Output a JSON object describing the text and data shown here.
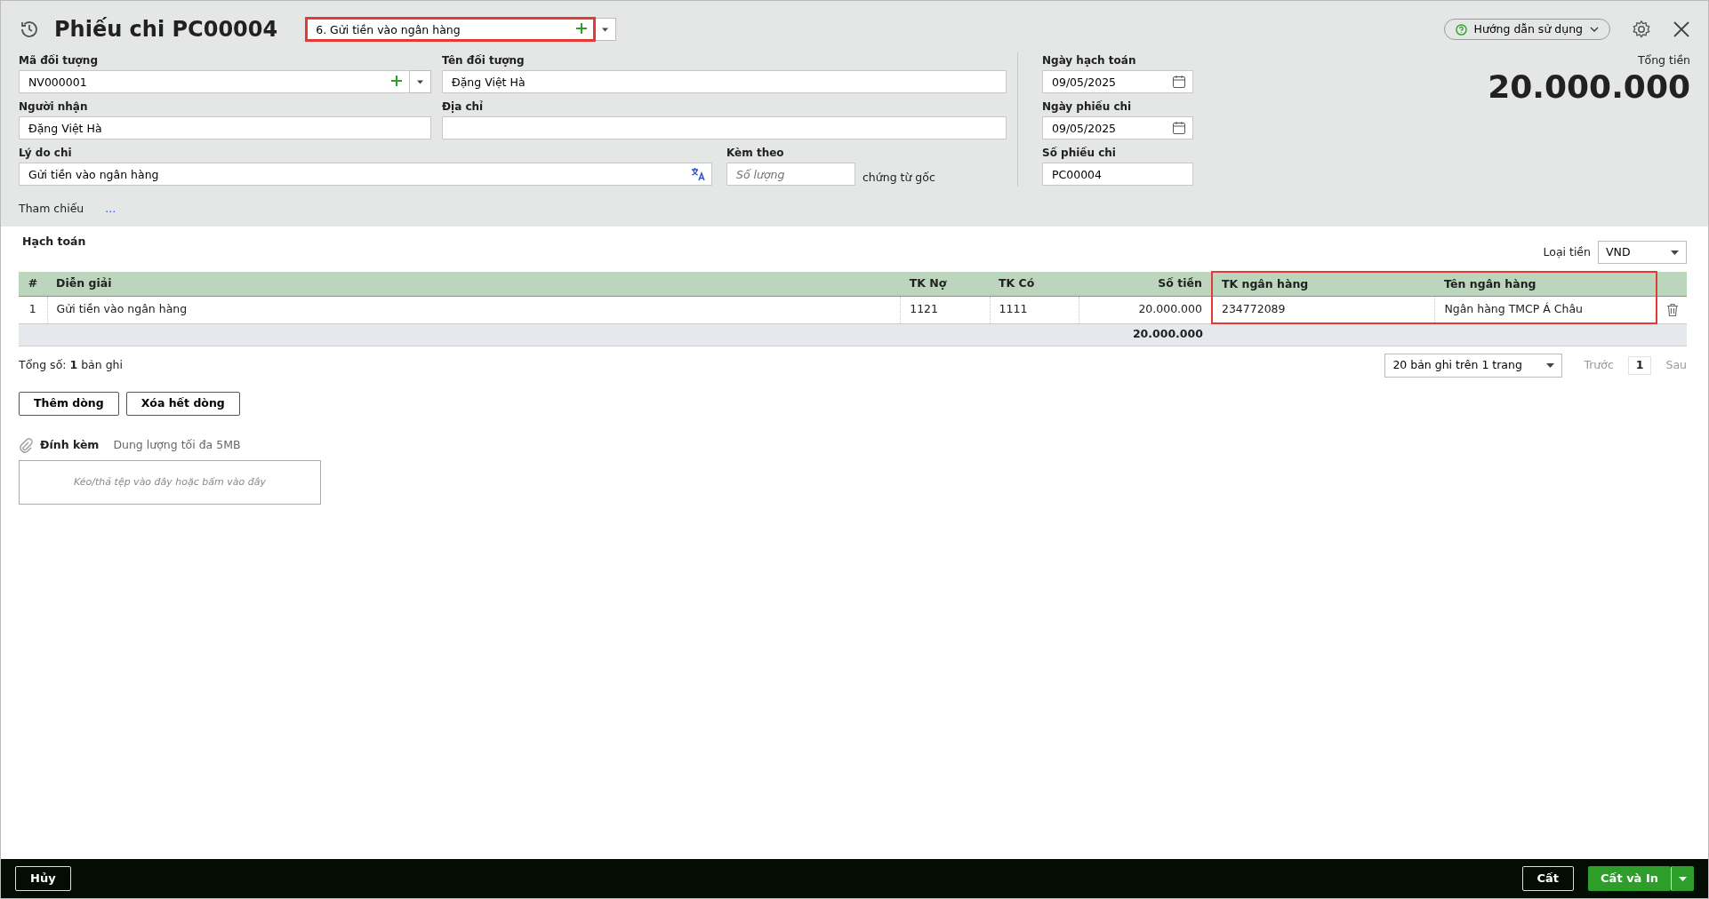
{
  "title": "Phiếu chi PC00004",
  "voucher_type": {
    "value": "6. Gửi tiền vào ngân hàng",
    "highlighted": true
  },
  "help_button": "Hướng dẫn sử dụng",
  "object_code": {
    "label": "Mã đối tượng",
    "value": "NV000001"
  },
  "object_name": {
    "label": "Tên đối tượng",
    "value": "Đặng Việt Hà"
  },
  "receiver": {
    "label": "Người nhận",
    "value": "Đặng Việt Hà"
  },
  "address": {
    "label": "Địa chỉ"
  },
  "reason": {
    "label": "Lý do chi",
    "value": "Gửi tiền vào ngân hàng"
  },
  "attached": {
    "label": "Kèm theo",
    "placeholder": "Số lượng",
    "suffix": "chứng từ gốc"
  },
  "posting_date": {
    "label": "Ngày hạch toán",
    "value": "09/05/2025"
  },
  "voucher_date": {
    "label": "Ngày phiếu chi",
    "value": "09/05/2025"
  },
  "voucher_no": {
    "label": "Số phiếu chi",
    "value": "PC00004"
  },
  "total": {
    "label": "Tổng tiền",
    "value": "20.000.000"
  },
  "reference": {
    "label": "Tham chiếu",
    "link": "..."
  },
  "accounting": {
    "title": "Hạch toán",
    "currency_label": "Loại tiền",
    "currency": "VND",
    "columns": [
      {
        "label": "#",
        "highlighted": false
      },
      {
        "label": "Diễn giải",
        "highlighted": false
      },
      {
        "label": "TK Nợ",
        "highlighted": false
      },
      {
        "label": "TK Có",
        "highlighted": false
      },
      {
        "label": "Số tiền",
        "highlighted": false
      },
      {
        "label": "TK ngân hàng",
        "highlighted": true
      },
      {
        "label": "Tên ngân hàng",
        "highlighted": true
      }
    ],
    "rows": [
      [
        "1",
        "Gửi tiền vào ngân hàng",
        "1121",
        "1111",
        "20.000.000",
        "234772089",
        "Ngân hàng TMCP Á Châu"
      ]
    ],
    "total": "20.000.000",
    "count_text": "Tổng số: **1** bản ghi",
    "page_size": "20 bản ghi trên 1 trang",
    "prev": "Trước",
    "page": "1",
    "next": "Sau"
  },
  "row_buttons": [
    "Thêm dòng",
    "Xóa hết dòng"
  ],
  "attachments": {
    "title": "Đính kèm",
    "note": "Dung lượng tối đa 5MB",
    "dropzone": "Kéo/thả tệp vào đây hoặc bấm vào đây"
  },
  "footer": {
    "cancel": "Hủy",
    "save": "Cất",
    "save_print": "Cất và In"
  }
}
